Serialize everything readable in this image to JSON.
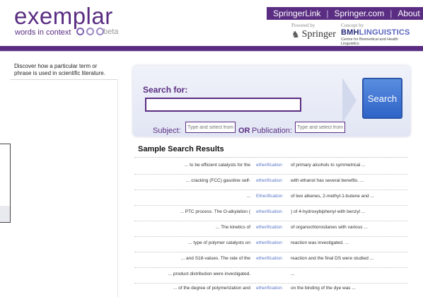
{
  "logo": {
    "word": "exemplar",
    "subtitle": "words in context",
    "beta": "beta"
  },
  "topnav": {
    "items": [
      "SpringerLink",
      "Springer.com",
      "About"
    ],
    "separator": "|"
  },
  "partners": {
    "powered_by": "Powered by",
    "springer": "Springer",
    "concept_by": "Concept by",
    "bmh_part1": "BMH",
    "bmh_part2": "LINGUISTICS",
    "bmh_sub": "Centre for Biomedical and Health Linguistics"
  },
  "sidebar": {
    "intro": "Discover how a particular term or phrase is used in scientific literature."
  },
  "search": {
    "label": "Search for:",
    "value": "",
    "button": "Search",
    "subject_label": "Subject:",
    "subject_placeholder": "Type and select from",
    "or_label": "OR",
    "publication_label": "Publication:",
    "publication_placeholder": "Type and select from"
  },
  "results": {
    "title": "Sample Search Results",
    "rows": [
      {
        "left": "... to be efficient catalysts for the",
        "keyword": "etherification",
        "right": "of primary alcohols to symmetrical ..."
      },
      {
        "left": "... cracking (FCC) gasoline self-",
        "keyword": "etherification",
        "right": "with ethanol has several benefits. ..."
      },
      {
        "left": "...",
        "keyword": "Etherification",
        "right": "of two alkenes, 2-methyl-1-butene and ..."
      },
      {
        "left": "... PTC process. The O-alkylation (",
        "keyword": "etherification",
        "right": ") of 4-hydroxybiphenyl with benzyl ..."
      },
      {
        "left": "... The kinetics of",
        "keyword": "etherification",
        "right": "of organochlorosilanes with various ..."
      },
      {
        "left": "... type of polymer catalysts on",
        "keyword": "etherification",
        "right": "reaction was investigated. ..."
      },
      {
        "left": "... and S18-values. The rate of the",
        "keyword": "etherification",
        "right": "reaction and the final DS were studied ..."
      },
      {
        "left": "... product distribution were investigated.",
        "keyword": "",
        "right": "..."
      },
      {
        "left": "... of the degree of polymerization and",
        "keyword": "etherification",
        "right": "on the binding of the dye was ..."
      }
    ]
  },
  "colors": {
    "brand_purple": "#5a2d82",
    "keyword_blue": "#5a76c8",
    "search_button": "#3f74d4"
  },
  "icons": [
    "springer-horse-icon",
    "logo-circles-icon",
    "chevron-arrow-icon"
  ]
}
